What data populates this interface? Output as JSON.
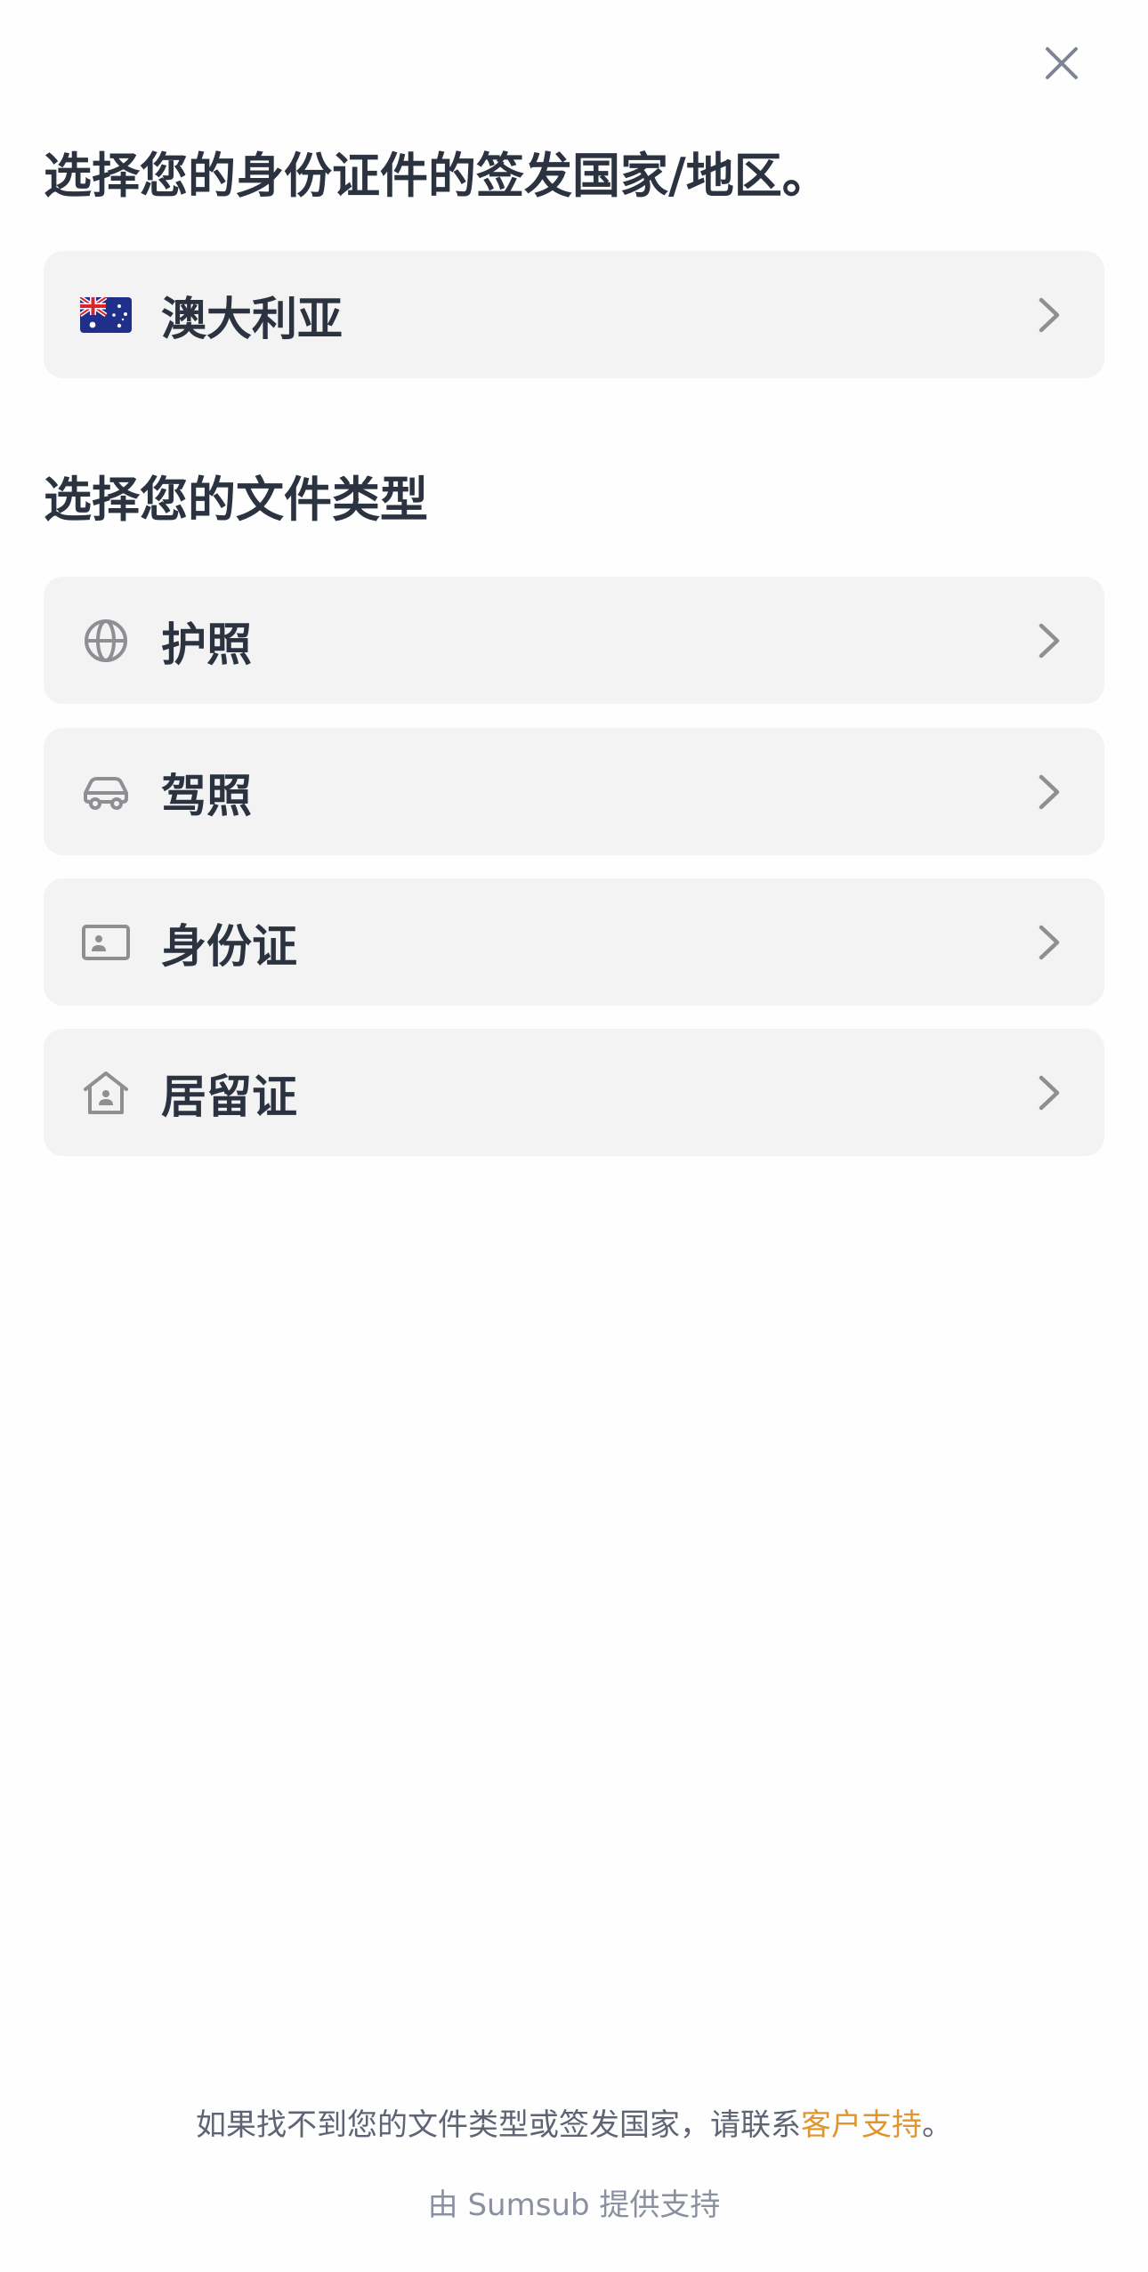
{
  "close_icon": "close-icon",
  "country_section": {
    "heading": "选择您的身份证件的签发国家/地区。",
    "selected_country": {
      "label": "澳大利亚",
      "flag_icon": "australia-flag-icon"
    }
  },
  "document_section": {
    "heading": "选择您的文件类型",
    "items": [
      {
        "label": "护照",
        "icon": "globe-icon"
      },
      {
        "label": "驾照",
        "icon": "car-icon"
      },
      {
        "label": "身份证",
        "icon": "id-card-icon"
      },
      {
        "label": "居留证",
        "icon": "house-icon"
      }
    ]
  },
  "footer": {
    "note_prefix": "如果找不到您的文件类型或签发国家，请联系",
    "support_link": "客户支持",
    "note_suffix": "。",
    "powered_by": "由 Sumsub 提供支持"
  },
  "colors": {
    "heading_text": "#2b3240",
    "row_background": "#f3f3f4",
    "icon_gray": "#8e8e93",
    "link_accent": "#e0952d"
  }
}
